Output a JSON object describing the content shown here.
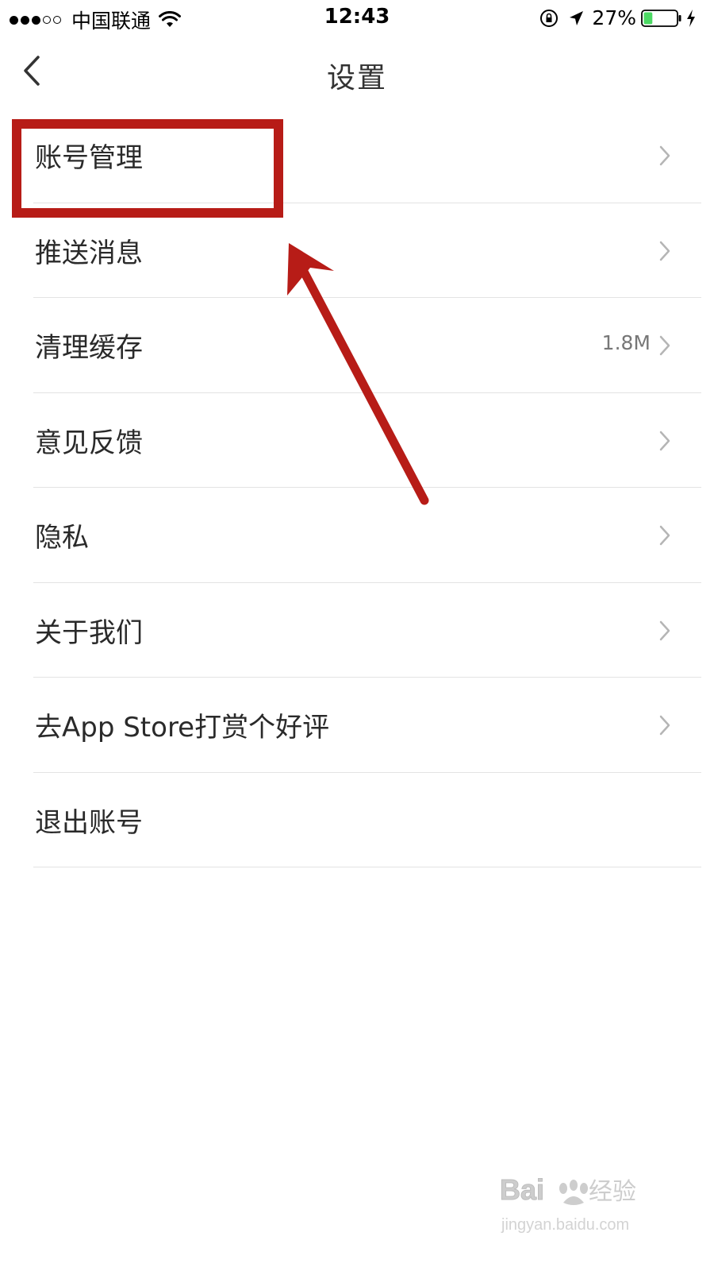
{
  "status_bar": {
    "carrier": "中国联通",
    "time": "12:43",
    "battery_percent": "27%",
    "battery_level": 0.27,
    "battery_color": "#4cd964"
  },
  "nav": {
    "title": "设置",
    "back_icon": "chevron-left-icon"
  },
  "settings": {
    "items": [
      {
        "label": "账号管理",
        "value": "",
        "has_chevron": true
      },
      {
        "label": "推送消息",
        "value": "",
        "has_chevron": true
      },
      {
        "label": "清理缓存",
        "value": "1.8M",
        "has_chevron": true
      },
      {
        "label": "意见反馈",
        "value": "",
        "has_chevron": true
      },
      {
        "label": "隐私",
        "value": "",
        "has_chevron": true
      },
      {
        "label": "关于我们",
        "value": "",
        "has_chevron": true
      },
      {
        "label": "去App Store打赏个好评",
        "value": "",
        "has_chevron": true
      },
      {
        "label": "退出账号",
        "value": "",
        "has_chevron": false
      }
    ]
  },
  "annotation": {
    "color": "#b71c17",
    "highlighted_item": "账号管理"
  },
  "watermark": {
    "brand": "Baidu经验",
    "url": "jingyan.baidu.com"
  }
}
